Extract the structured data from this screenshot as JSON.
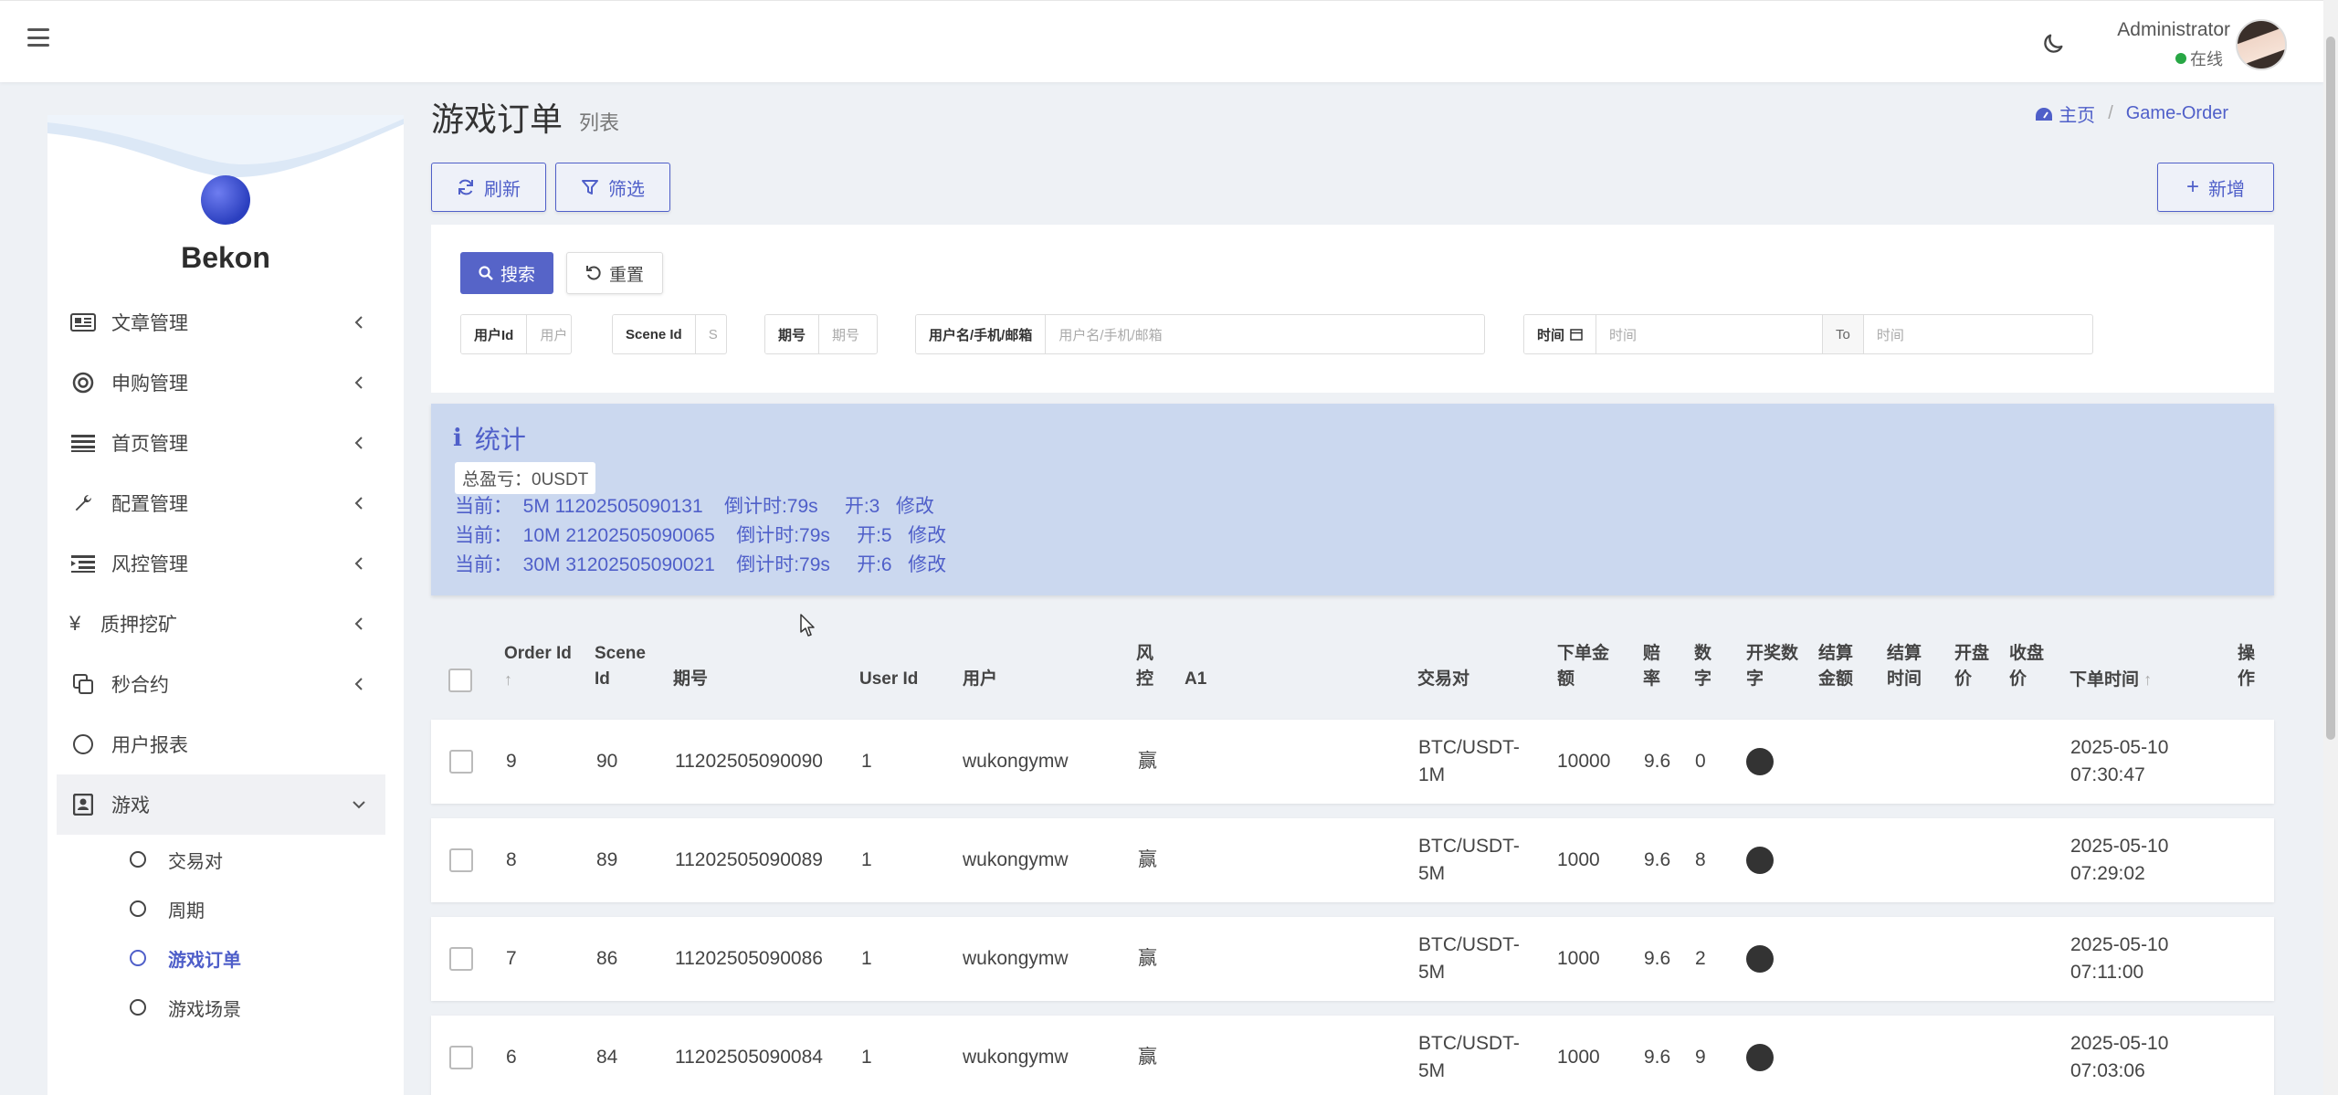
{
  "header": {
    "user_name": "Administrator",
    "user_status": "在线"
  },
  "sidebar": {
    "brand": "Bekon",
    "items": [
      {
        "label": "文章管理",
        "icon": "newspaper-icon"
      },
      {
        "label": "申购管理",
        "icon": "lifebuoy-icon"
      },
      {
        "label": "首页管理",
        "icon": "list-icon"
      },
      {
        "label": "配置管理",
        "icon": "wrench-icon"
      },
      {
        "label": "风控管理",
        "icon": "indent-list-icon"
      },
      {
        "label": "质押挖矿",
        "icon": "yen-icon"
      },
      {
        "label": "秒合约",
        "icon": "copy-icon"
      },
      {
        "label": "用户报表",
        "icon": "circle-icon"
      },
      {
        "label": "游戏",
        "icon": "id-badge-icon"
      }
    ],
    "sub_items": [
      "交易对",
      "周期",
      "游戏订单",
      "游戏场景"
    ]
  },
  "page": {
    "title": "游戏订单",
    "subtitle": "列表",
    "breadcrumb_home": "主页",
    "breadcrumb_current": "Game-Order"
  },
  "toolbar": {
    "refresh": "刷新",
    "filter": "筛选",
    "add": "新增"
  },
  "filter": {
    "search": "搜索",
    "reset": "重置",
    "fields": [
      {
        "label": "用户Id",
        "placeholder": "用户"
      },
      {
        "label": "Scene Id",
        "placeholder": "S"
      },
      {
        "label": "期号",
        "placeholder": "期号"
      },
      {
        "label": "用户名/手机/邮箱",
        "placeholder": "用户名/手机/邮箱"
      },
      {
        "label": "时间",
        "placeholder": "时间"
      }
    ],
    "to_label": "To",
    "to_placeholder": "时间"
  },
  "stats": {
    "title": "统计",
    "total": "总盈亏：0USDT",
    "lines": [
      "当前：  5M 11202505090131    倒计时:79s     开:3   修改",
      "当前：  10M 21202505090065    倒计时:79s     开:5   修改",
      "当前：  30M 31202505090021    倒计时:79s     开:6   修改"
    ]
  },
  "table": {
    "headers": {
      "order_id": "Order Id",
      "scene_id_1": "Scene",
      "scene_id_2": "Id",
      "period": "期号",
      "user_id": "User Id",
      "user": "用户",
      "risk_1": "风",
      "risk_2": "控",
      "a1": "A1",
      "pair": "交易对",
      "amount_1": "下单金",
      "amount_2": "额",
      "odds_1": "赔",
      "odds_2": "率",
      "num_1": "数",
      "num_2": "字",
      "draw_1": "开奖数",
      "draw_2": "字",
      "settle_amt_1": "结算",
      "settle_amt_2": "金额",
      "settle_time_1": "结算",
      "settle_time_2": "时间",
      "open_1": "开盘",
      "open_2": "价",
      "close_1": "收盘",
      "close_2": "价",
      "time": "下单时间",
      "ops_1": "操",
      "ops_2": "作"
    },
    "rows": [
      {
        "id": "9",
        "scene": "90",
        "period": "11202505090090",
        "user_id": "1",
        "user": "wukongymw",
        "risk": "赢",
        "pair_1": "BTC/USDT-",
        "pair_2": "1M",
        "amount": "10000",
        "odds": "9.6",
        "num": "0",
        "date": "2025-05-10",
        "time": "07:30:47"
      },
      {
        "id": "8",
        "scene": "89",
        "period": "11202505090089",
        "user_id": "1",
        "user": "wukongymw",
        "risk": "赢",
        "pair_1": "BTC/USDT-",
        "pair_2": "5M",
        "amount": "1000",
        "odds": "9.6",
        "num": "8",
        "date": "2025-05-10",
        "time": "07:29:02"
      },
      {
        "id": "7",
        "scene": "86",
        "period": "11202505090086",
        "user_id": "1",
        "user": "wukongymw",
        "risk": "赢",
        "pair_1": "BTC/USDT-",
        "pair_2": "5M",
        "amount": "1000",
        "odds": "9.6",
        "num": "2",
        "date": "2025-05-10",
        "time": "07:11:00"
      },
      {
        "id": "6",
        "scene": "84",
        "period": "11202505090084",
        "user_id": "1",
        "user": "wukongymw",
        "risk": "赢",
        "pair_1": "BTC/USDT-",
        "pair_2": "5M",
        "amount": "1000",
        "odds": "9.6",
        "num": "9",
        "date": "2025-05-10",
        "time": "07:03:06"
      }
    ]
  },
  "colors": {
    "accent": "#4f5fc9",
    "stats_bg": "#cbd8ef",
    "online": "#28a745"
  }
}
